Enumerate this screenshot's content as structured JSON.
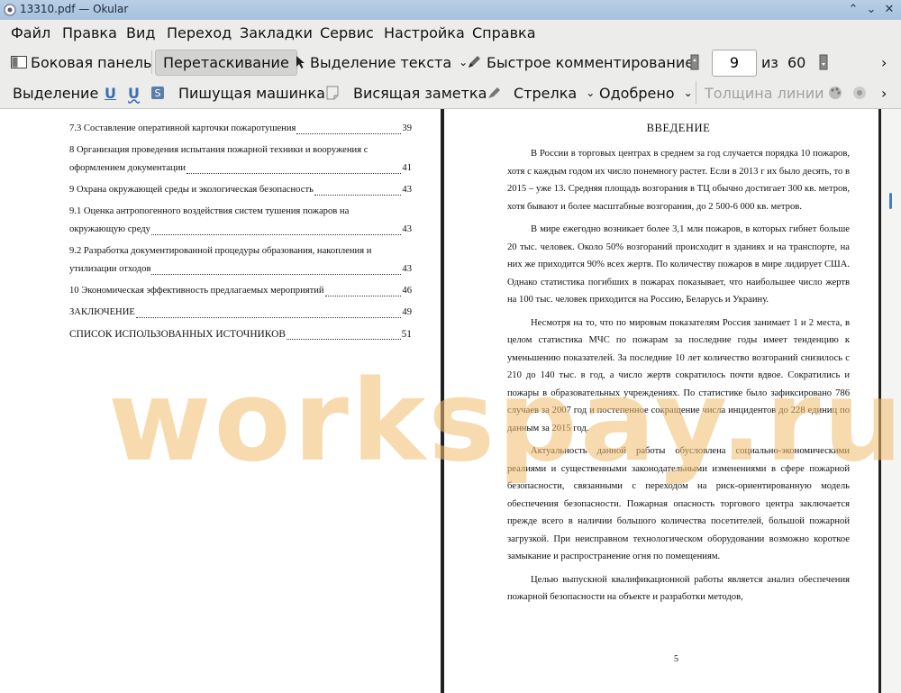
{
  "window": {
    "title": "13310.pdf  — Okular"
  },
  "menu": [
    "Файл",
    "Правка",
    "Вид",
    "Переход",
    "Закладки",
    "Сервис",
    "Настройка",
    "Справка"
  ],
  "toolbar1": {
    "sidebar": "Боковая панель",
    "drag": "Перетаскивание",
    "select_text": "Выделение текста",
    "quick_comment": "Быстрое комментирование",
    "page_current": "9",
    "of_label": "из",
    "page_total": "60"
  },
  "toolbar2": {
    "selection": "Выделение",
    "typewriter": "Пишущая машинка",
    "note": "Висящая заметка",
    "arrow": "Стрелка",
    "approved": "Одобрено",
    "line_width": "Толщина линии"
  },
  "toc": [
    {
      "title": "7.3 Составление оперативной карточки пожаротушения",
      "page": "39"
    },
    {
      "title": "8 Организация проведения испытания пожарной техники и вооружения с",
      "cont": "оформлением документации",
      "page": "41"
    },
    {
      "title": "9 Охрана окружающей среды и экологическая безопасность",
      "page": "43"
    },
    {
      "title": "9.1 Оценка антропогенного воздействия систем тушения пожаров на",
      "cont": "окружающую среду",
      "page": "43"
    },
    {
      "title": "9.2 Разработка документированной процедуры образования, накопления и",
      "cont": "утилизации отходов",
      "page": "43"
    },
    {
      "title": "10 Экономическая эффективность предлагаемых мероприятий",
      "page": "46"
    },
    {
      "title": "ЗАКЛЮЧЕНИЕ",
      "page": "49"
    },
    {
      "title": "СПИСОК ИСПОЛЬЗОВАННЫХ ИСТОЧНИКОВ",
      "page": "51",
      "big": true
    }
  ],
  "doc": {
    "heading": "ВВЕДЕНИЕ",
    "paragraphs": [
      "В России в торговых центрах в среднем за год случается порядка 10 пожаров, хотя с каждым годом их число понемногу растет. Если в 2013 г их было десять, то в 2015 – уже 13. Средняя площадь возгорания в ТЦ обычно достигает 300 кв. метров, хотя бывают и более масштабные возгорания, до 2 500-6 000 кв. метров.",
      "В мире ежегодно возникает более 3,1 млн пожаров, в которых гибнет больше 20 тыс. человек. Около 50% возгораний происходит в зданиях и на транспорте, на них же приходится 90% всех жертв. По количеству пожаров в мире лидирует США. Однако статистика погибших в пожарах показывает, что наибольшее число жертв на 100 тыс. человек приходится на Россию, Беларусь и Украину.",
      "Несмотря на то, что по мировым показателям Россия занимает 1 и 2 места, в целом статистика МЧС по пожарам за последние годы имеет тенденцию к уменьшению показателей. За последние 10 лет количество возгораний снизилось с 210 до 140 тыс. в год, а число жертв сократилось почти вдвое. Сократились и пожары в образовательных учреждениях. По статистике было зафиксировано 786 случаев за 2007 год и постепенное сокращение числа инцидентов до 228 единиц по данным за 2015 год.",
      "Актуальность данной работы обусловлена социально-экономическими реалиями и существенными законодательными изменениями в сфере пожарной безопасности, связанными с переходом на риск-ориентированную модель обеспечения безопасности. Пожарная опасность торгового центра заключается прежде всего в наличии большого количества посетителей, большой пожарной загрузкой. При неисправном технологическом оборудовании возможно короткое замыкание и распространение огня по помещениям.",
      "Целью выпускной квалификационной работы является анализ обеспечения пожарной безопасности на объекте и разработки методов,"
    ],
    "page_number": "5"
  },
  "watermark": "workspay.ru"
}
